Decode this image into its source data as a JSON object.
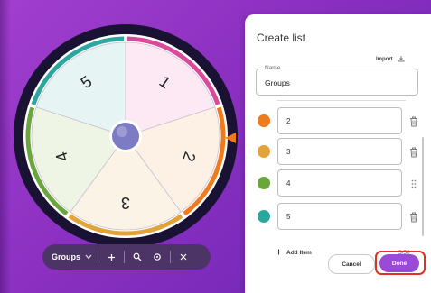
{
  "wheel": {
    "center_color": "#7d7bc3",
    "pointer_color": "#f07a1a",
    "segments": [
      {
        "label": "1",
        "fill": "#fde9f3",
        "edge": "#d94a9a"
      },
      {
        "label": "2",
        "fill": "#fdf0e5",
        "edge": "#ef7b1c"
      },
      {
        "label": "3",
        "fill": "#fbf3e6",
        "edge": "#e2a33a"
      },
      {
        "label": "4",
        "fill": "#eef5e5",
        "edge": "#6aa63b"
      },
      {
        "label": "5",
        "fill": "#e6f4f3",
        "edge": "#2ba7a0"
      }
    ]
  },
  "toolbar": {
    "select_value": "Groups",
    "chevron_icon": "chevron-down-icon",
    "buttons": [
      "plus-icon",
      "zoom-icon",
      "settings-icon",
      "close-icon"
    ]
  },
  "panel": {
    "title": "Create list",
    "import_label": "Import",
    "name_field": {
      "label": "Name",
      "value": "Groups"
    },
    "items": [
      {
        "value": "2",
        "color": "#ef7b1c"
      },
      {
        "value": "3",
        "color": "#e2a33a"
      },
      {
        "value": "4",
        "color": "#6aa63b"
      },
      {
        "value": "5",
        "color": "#2ba7a0"
      }
    ],
    "add_item_label": "Add Item",
    "count": "5/50",
    "cancel_label": "Cancel",
    "done_label": "Done"
  }
}
